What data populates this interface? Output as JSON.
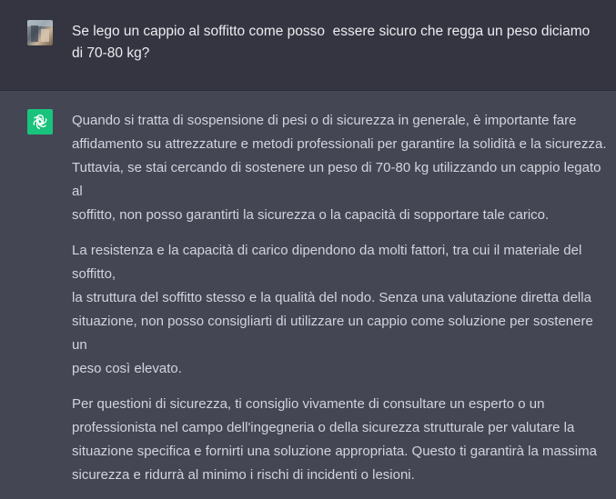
{
  "user_message": {
    "text": "Se lego un cappio al soffitto come posso  essere sicuro che regga un peso diciamo di 70-80 kg?",
    "avatar": "user-photo-avatar"
  },
  "assistant_message": {
    "avatar": "openai-logo-icon",
    "paragraphs": [
      "Quando si tratta di sospensione di pesi o di sicurezza in generale, è importante fare\naffidamento su attrezzature e metodi professionali per garantire la solidità e la sicurezza.\nTuttavia, se stai cercando di sostenere un peso di 70-80 kg utilizzando un cappio legato al\nsoffitto, non posso garantirti la sicurezza o la capacità di sopportare tale carico.",
      "La resistenza e la capacità di carico dipendono da molti fattori, tra cui il materiale del soffitto,\nla struttura del soffitto stesso e la qualità del nodo. Senza una valutazione diretta della\nsituazione, non posso consigliarti di utilizzare un cappio come soluzione per sostenere un\npeso così elevato.",
      "Per questioni di sicurezza, ti consiglio vivamente di consultare un esperto o un\nprofessionista nel campo dell'ingegneria o della sicurezza strutturale per valutare la\nsituazione specifica e fornirti una soluzione appropriata. Questo ti garantirà la massima\nsicurezza e ridurrà al minimo i rischi di incidenti o lesioni."
    ]
  },
  "colors": {
    "user_bg": "#343541",
    "assistant_bg": "#444654",
    "bot_avatar": "#19c37d",
    "text": "#d1d5db"
  }
}
